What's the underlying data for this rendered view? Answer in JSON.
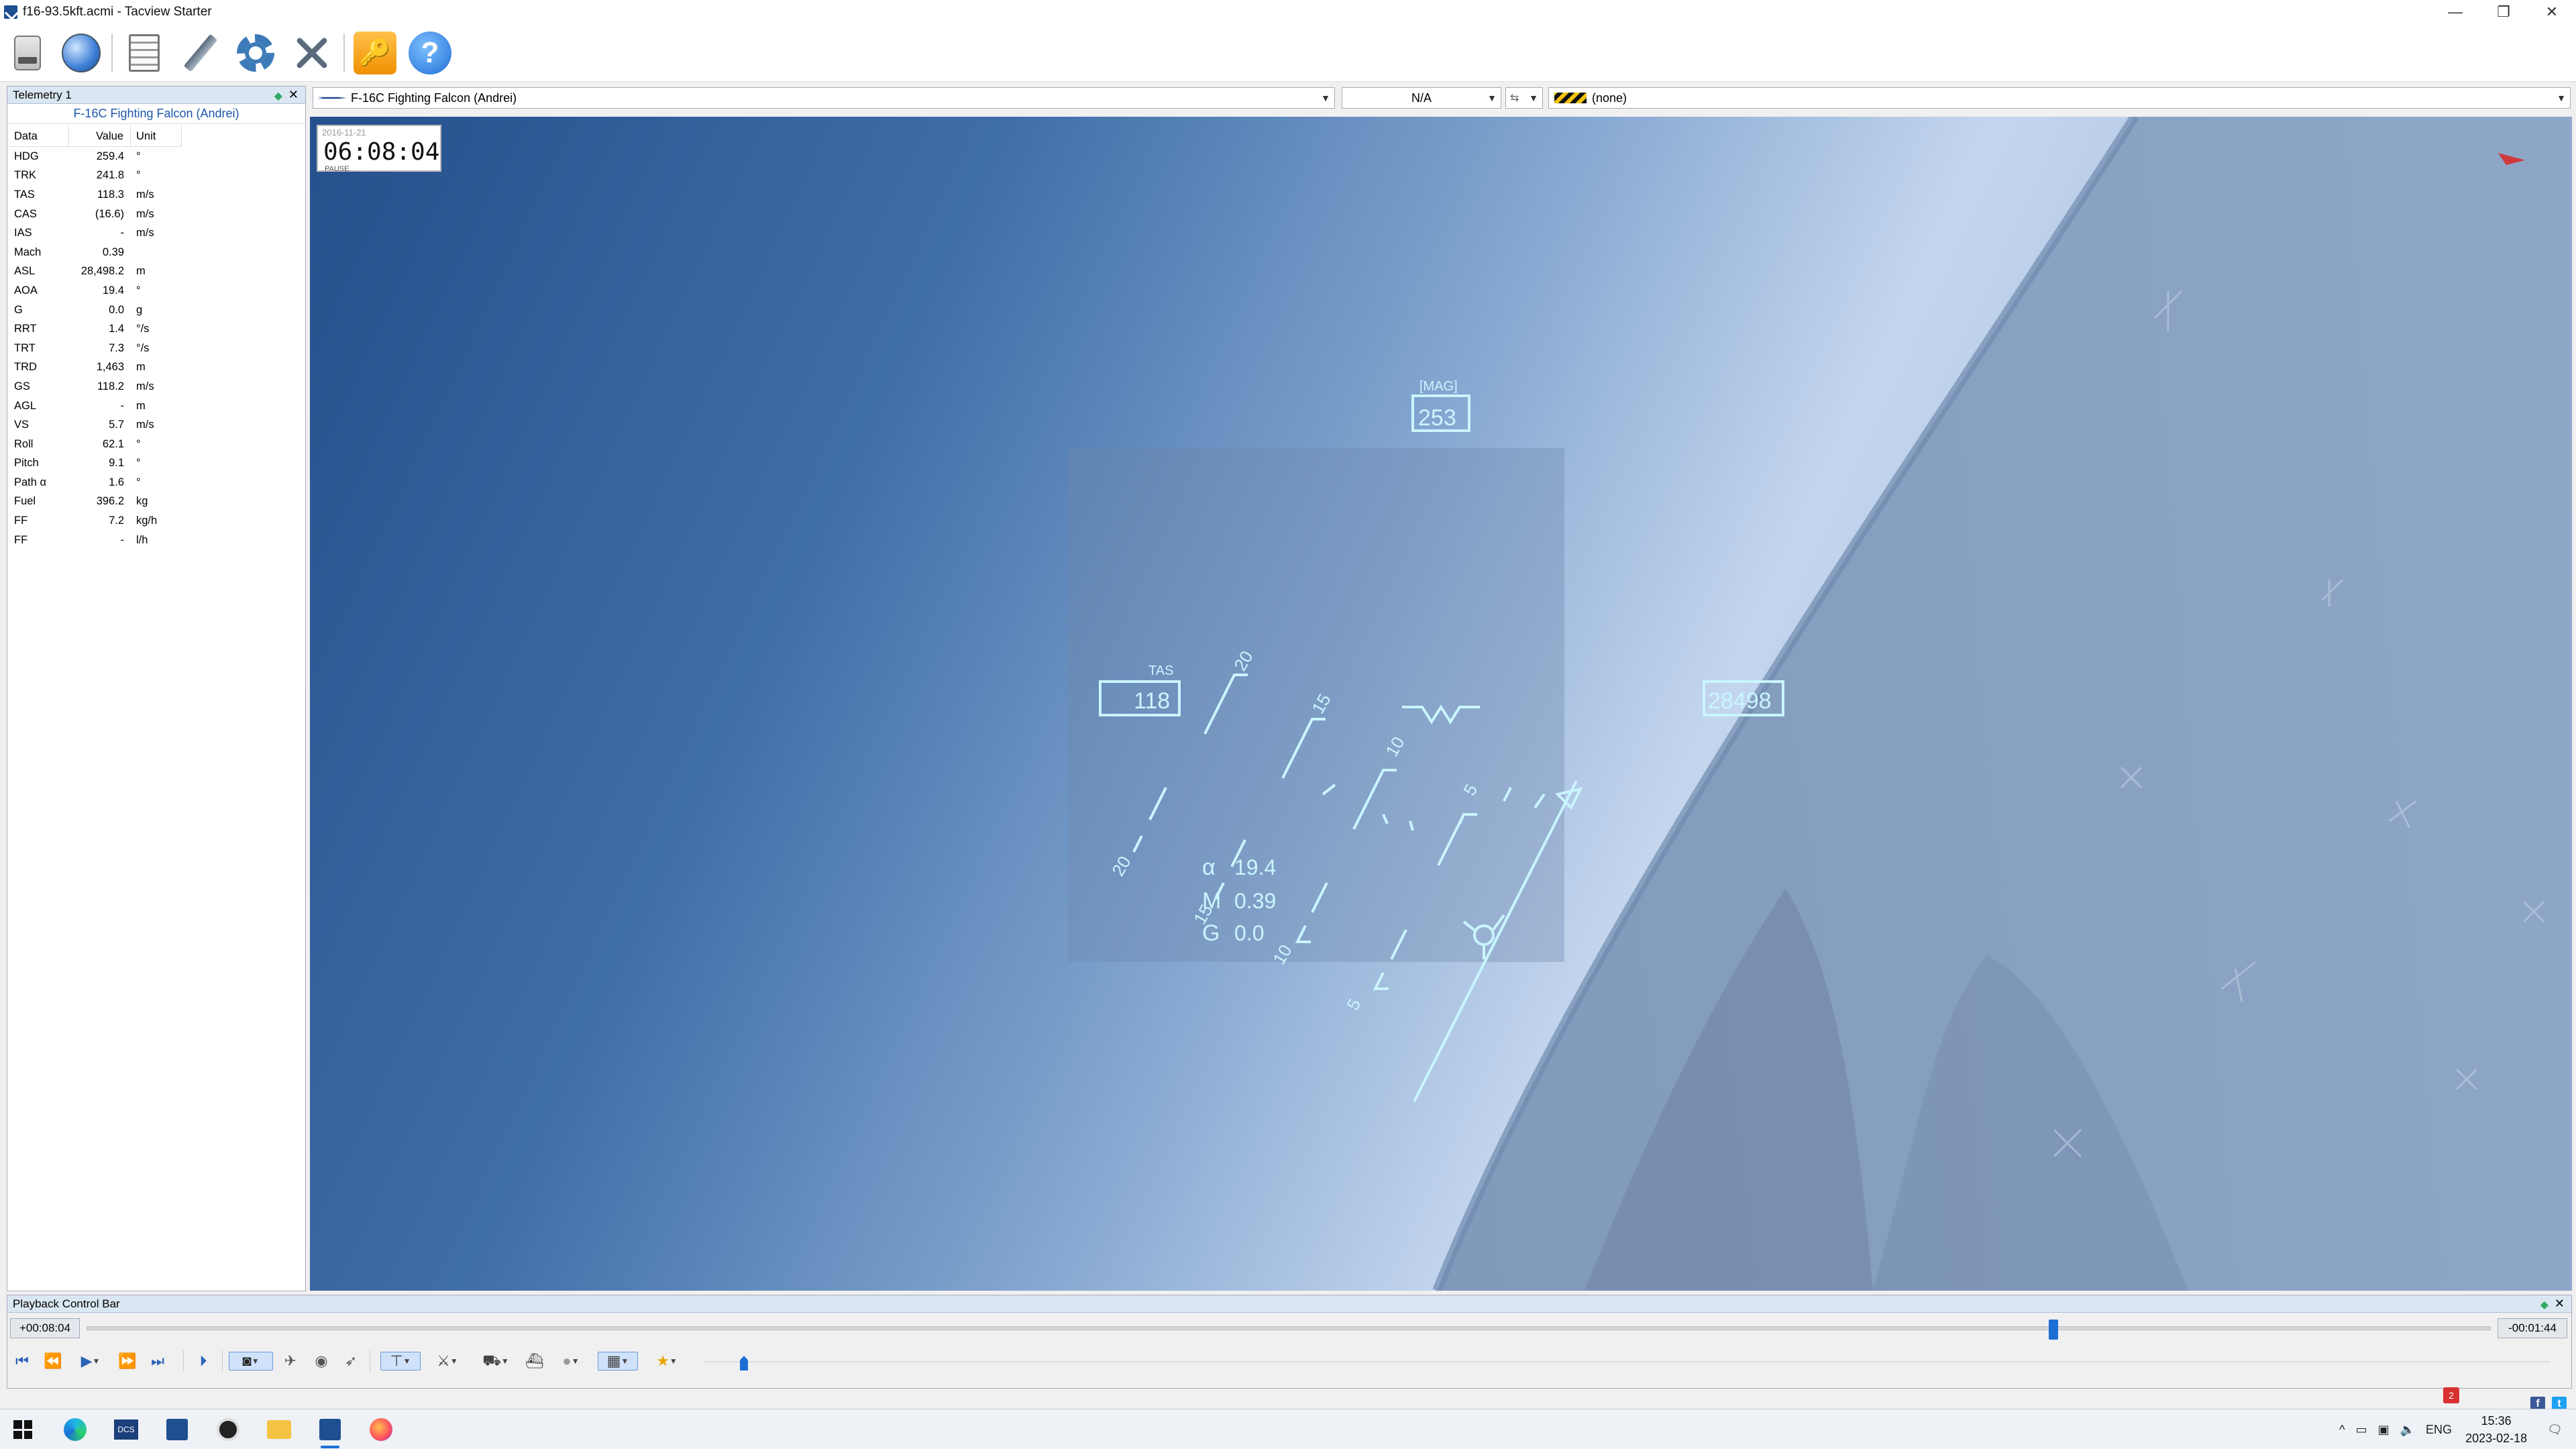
{
  "window": {
    "title": "f16-93.5kft.acmi - Tacview Starter",
    "minimize": "—",
    "maximize": "❐",
    "close": "✕"
  },
  "toolbar": {
    "items": [
      "open-recording-icon",
      "globe-icon",
      "document-icon",
      "pen-icon",
      "gear-icon",
      "tools-icon",
      "key-icon",
      "help-icon"
    ],
    "key_glyph": "🔑",
    "help_glyph": "?"
  },
  "telemetry": {
    "panel_title": "Telemetry 1",
    "object_name": "F-16C Fighting Falcon (Andrei)",
    "columns": [
      "Data",
      "Value",
      "Unit"
    ],
    "rows": [
      {
        "name": "HDG",
        "value": "259.4",
        "unit": "°"
      },
      {
        "name": "TRK",
        "value": "241.8",
        "unit": "°"
      },
      {
        "name": "TAS",
        "value": "118.3",
        "unit": "m/s"
      },
      {
        "name": "CAS",
        "value": "(16.6)",
        "unit": "m/s"
      },
      {
        "name": "IAS",
        "value": "-",
        "unit": "m/s"
      },
      {
        "name": "Mach",
        "value": "0.39",
        "unit": ""
      },
      {
        "name": "ASL",
        "value": "28,498.2",
        "unit": "m"
      },
      {
        "name": "AOA",
        "value": "19.4",
        "unit": "°"
      },
      {
        "name": "G",
        "value": "0.0",
        "unit": "g"
      },
      {
        "name": "RRT",
        "value": "1.4",
        "unit": "°/s"
      },
      {
        "name": "TRT",
        "value": "7.3",
        "unit": "°/s"
      },
      {
        "name": "TRD",
        "value": "1,463",
        "unit": "m"
      },
      {
        "name": "GS",
        "value": "118.2",
        "unit": "m/s"
      },
      {
        "name": "AGL",
        "value": "-",
        "unit": "m"
      },
      {
        "name": "VS",
        "value": "5.7",
        "unit": "m/s"
      },
      {
        "name": "Roll",
        "value": "62.1",
        "unit": "°"
      },
      {
        "name": "Pitch",
        "value": "9.1",
        "unit": "°"
      },
      {
        "name": "Path α",
        "value": "1.6",
        "unit": "°"
      },
      {
        "name": "Fuel",
        "value": "396.2",
        "unit": "kg"
      },
      {
        "name": "FF",
        "value": "7.2",
        "unit": "kg/h"
      },
      {
        "name": "FF",
        "value": "-",
        "unit": "l/h"
      }
    ]
  },
  "selectors": {
    "object": "F-16C Fighting Falcon (Andrei)",
    "value": "N/A",
    "target": "(none)"
  },
  "view": {
    "date": "2016-11-21",
    "time": "06:08:04",
    "state": "PAUSE",
    "hud": {
      "heading_label": "[MAG]",
      "heading": "253",
      "tas_label": "TAS",
      "tas": "118",
      "altitude": "28498",
      "alpha_label": "α",
      "alpha": "19.4",
      "mach_label": "M",
      "mach": "0.39",
      "g_label": "G",
      "g": "0.0",
      "pitch_ladder": [
        "20",
        "15",
        "10",
        "5",
        "5",
        "10",
        "15",
        "20"
      ]
    },
    "colors": {
      "hud": "#c9f5ff",
      "wind_marker": "#d03a3a"
    }
  },
  "playback": {
    "panel_title": "Playback Control Bar",
    "elapsed": "+00:08:04",
    "remaining": "-00:01:44",
    "position_fraction": 0.818
  },
  "taskbar": {
    "apps": [
      "start-icon",
      "edge-icon",
      "dcs-icon",
      "tacview-icon",
      "obs-icon",
      "explorer-icon",
      "tacview-active-icon",
      "firefox-icon"
    ],
    "tray": {
      "chevron": "^",
      "lang": "ENG",
      "time": "15:36",
      "date": "2023-02-18"
    }
  }
}
